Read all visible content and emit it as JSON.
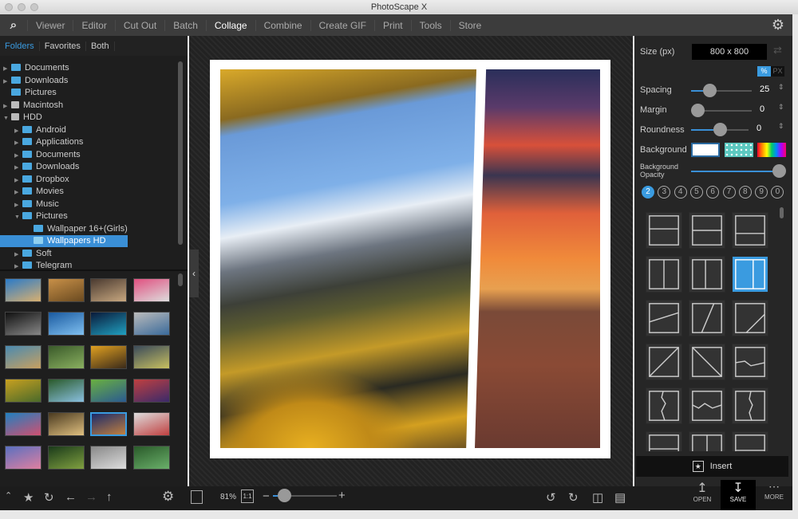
{
  "window": {
    "title": "PhotoScape X"
  },
  "menu": {
    "items": [
      "Viewer",
      "Editor",
      "Cut Out",
      "Batch",
      "Collage",
      "Combine",
      "Create GIF",
      "Print",
      "Tools",
      "Store"
    ],
    "active": "Collage"
  },
  "left": {
    "tabs": [
      "Folders",
      "Favorites",
      "Both"
    ],
    "active_tab": "Folders",
    "tree": [
      {
        "label": "Documents",
        "depth": 0,
        "arrow": "right",
        "icon": "folder"
      },
      {
        "label": "Downloads",
        "depth": 0,
        "arrow": "right",
        "icon": "folder"
      },
      {
        "label": "Pictures",
        "depth": 0,
        "arrow": "",
        "icon": "folder"
      },
      {
        "label": "Macintosh",
        "depth": 0,
        "arrow": "right",
        "icon": "drive"
      },
      {
        "label": "HDD",
        "depth": 0,
        "arrow": "down",
        "icon": "drive"
      },
      {
        "label": "Android",
        "depth": 1,
        "arrow": "right",
        "icon": "folder"
      },
      {
        "label": "Applications",
        "depth": 1,
        "arrow": "right",
        "icon": "folder"
      },
      {
        "label": "Documents",
        "depth": 1,
        "arrow": "right",
        "icon": "folder"
      },
      {
        "label": "Downloads",
        "depth": 1,
        "arrow": "right",
        "icon": "folder"
      },
      {
        "label": "Dropbox",
        "depth": 1,
        "arrow": "right",
        "icon": "folder"
      },
      {
        "label": "Movies",
        "depth": 1,
        "arrow": "right",
        "icon": "folder"
      },
      {
        "label": "Music",
        "depth": 1,
        "arrow": "right",
        "icon": "folder"
      },
      {
        "label": "Pictures",
        "depth": 1,
        "arrow": "down",
        "icon": "folder"
      },
      {
        "label": "Wallpaper 16+(Girls)",
        "depth": 2,
        "arrow": "",
        "icon": "folder"
      },
      {
        "label": "Wallpapers HD",
        "depth": 2,
        "arrow": "",
        "icon": "folder",
        "selected": true
      },
      {
        "label": "Soft",
        "depth": 1,
        "arrow": "right",
        "icon": "folder"
      },
      {
        "label": "Telegram",
        "depth": 1,
        "arrow": "right",
        "icon": "folder"
      }
    ]
  },
  "bottom": {
    "zoom": "81%",
    "actual_size": "1:1",
    "zoom_level_percent": 81,
    "open": "OPEN",
    "save": "SAVE",
    "more": "MORE"
  },
  "right": {
    "size_label": "Size (px)",
    "size_value": "800 x 800",
    "unit_percent": "%",
    "unit_px": "PX",
    "spacing_label": "Spacing",
    "spacing_value": "25",
    "margin_label": "Margin",
    "margin_value": "0",
    "roundness_label": "Roundness",
    "roundness_value": "0",
    "background_label": "Background",
    "opacity_label": "Background Opacity",
    "opacity_percent": 100,
    "counts": [
      "2",
      "3",
      "4",
      "5",
      "6",
      "7",
      "8",
      "9",
      "0"
    ],
    "active_count": "2",
    "insert": "Insert"
  },
  "colors": {
    "accent": "#3a9be0",
    "panel": "#262626",
    "menubar": "#3c3c3c"
  }
}
